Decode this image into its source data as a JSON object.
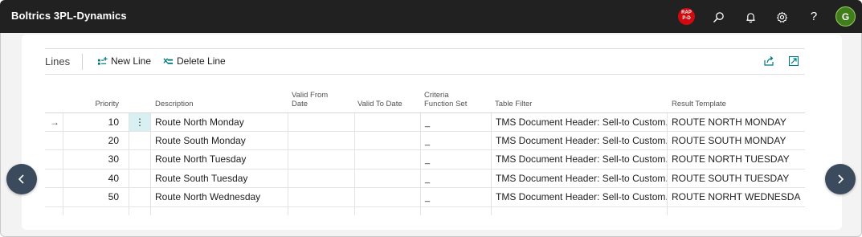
{
  "app": {
    "title": "Boltrics 3PL-Dynamics"
  },
  "topbar": {
    "badge": {
      "line1": "RAP",
      "line2": "P-D",
      "color": "#d10a10"
    },
    "icons": [
      "search-icon",
      "bell-icon",
      "gear-icon",
      "help-icon"
    ],
    "help_label": "?",
    "avatar_initial": "G"
  },
  "actionbar": {
    "caption": "Lines",
    "new_line": "New Line",
    "delete_line": "Delete Line"
  },
  "grid": {
    "headers": {
      "priority": "Priority",
      "description": "Description",
      "valid_from_l1": "Valid From",
      "valid_from_l2": "Date",
      "valid_to": "Valid To Date",
      "criteria_l1": "Criteria",
      "criteria_l2": "Function Set",
      "table_filter": "Table Filter",
      "result_template": "Result Template"
    },
    "current_row_marker": "→",
    "row_menu": "⋮",
    "rows": [
      {
        "priority": "10",
        "description": "Route North Monday",
        "valid_from": "",
        "valid_to": "",
        "criteria": "_",
        "table_filter": "TMS Document Header: Sell-to Custom...",
        "result_template": "ROUTE NORTH MONDAY"
      },
      {
        "priority": "20",
        "description": "Route South Monday",
        "valid_from": "",
        "valid_to": "",
        "criteria": "_",
        "table_filter": "TMS Document Header: Sell-to Custom...",
        "result_template": "ROUTE SOUTH MONDAY"
      },
      {
        "priority": "30",
        "description": "Route North Tuesday",
        "valid_from": "",
        "valid_to": "",
        "criteria": "_",
        "table_filter": "TMS Document Header: Sell-to Custom...",
        "result_template": "ROUTE NORTH TUESDAY"
      },
      {
        "priority": "40",
        "description": "Route South Tuesday",
        "valid_from": "",
        "valid_to": "",
        "criteria": "_",
        "table_filter": "TMS Document Header: Sell-to Custom...",
        "result_template": "ROUTE SOUTH TUESDAY"
      },
      {
        "priority": "50",
        "description": "Route North Wednesday",
        "valid_from": "",
        "valid_to": "",
        "criteria": "_",
        "table_filter": "TMS Document Header: Sell-to Custom...",
        "result_template": "ROUTE NORHT WEDNESDA"
      }
    ]
  },
  "nav": {
    "prev_icon": "chevron-left-icon",
    "next_icon": "chevron-right-icon"
  },
  "colors": {
    "topbar": "#212121",
    "accent": "#00777d",
    "selected_cell": "#d8f0f2",
    "nav_button": "#3b4a5c"
  }
}
